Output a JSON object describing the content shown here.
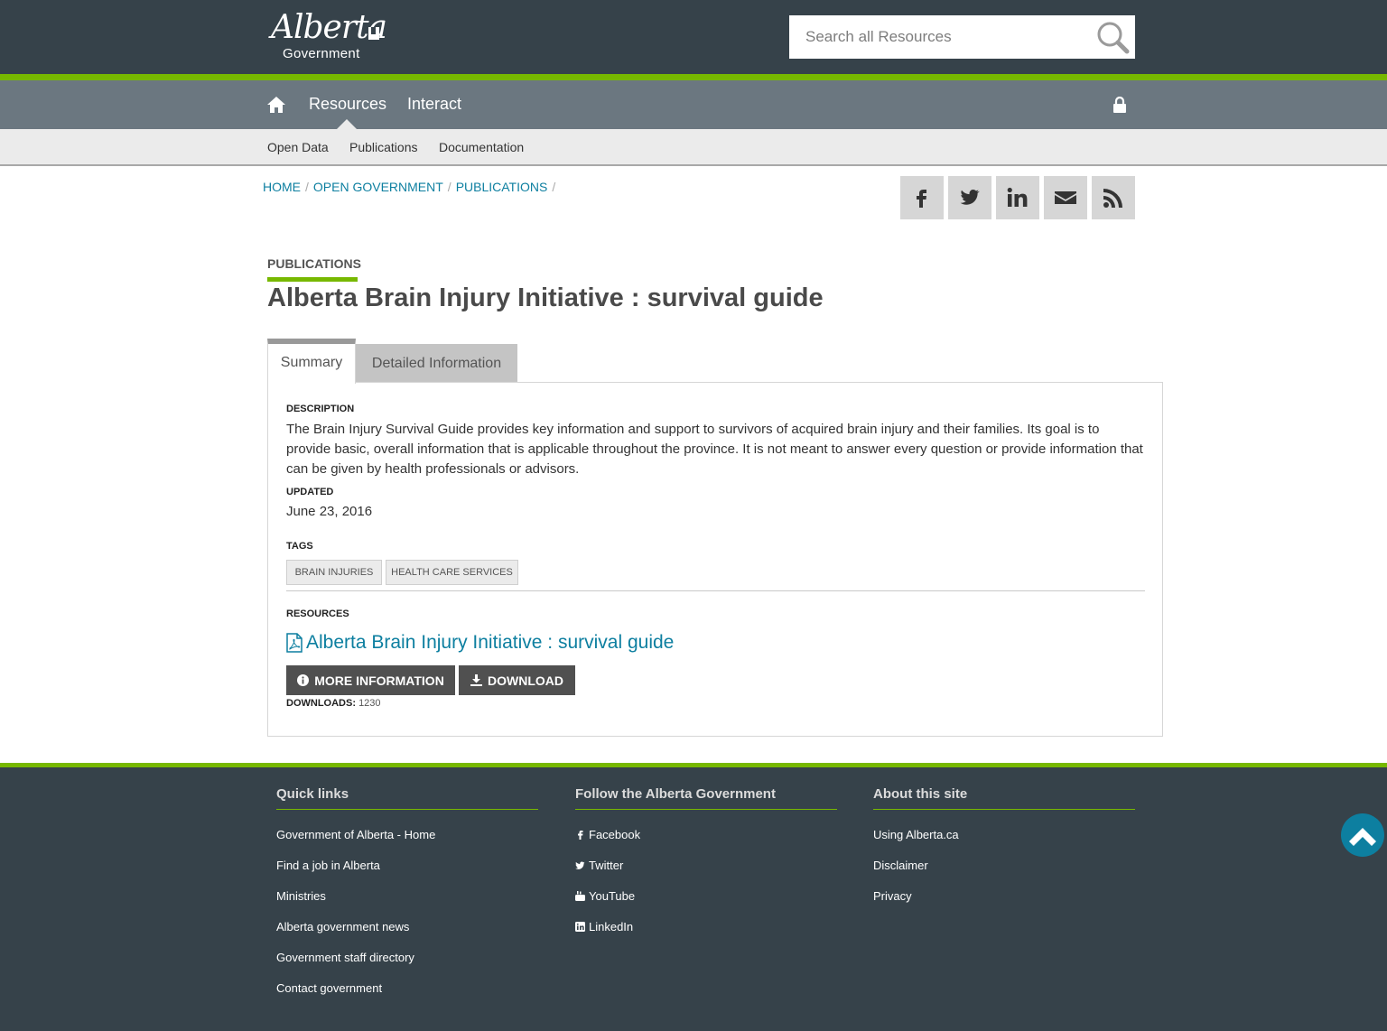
{
  "header": {
    "logo_script": "Alberta",
    "logo_sub": "Government",
    "search_placeholder": "Search all Resources"
  },
  "nav": {
    "items": [
      "Resources",
      "Interact"
    ],
    "subnav": [
      "Open Data",
      "Publications",
      "Documentation"
    ]
  },
  "breadcrumb": [
    "HOME",
    "OPEN GOVERNMENT",
    "PUBLICATIONS"
  ],
  "share_icons": [
    "facebook-icon",
    "twitter-icon",
    "linkedin-icon",
    "email-icon",
    "rss-icon"
  ],
  "page": {
    "kicker": "PUBLICATIONS",
    "title": "Alberta Brain Injury Initiative : survival guide"
  },
  "tabs": [
    "Summary",
    "Detailed Information"
  ],
  "summary": {
    "description_label": "DESCRIPTION",
    "description": "The Brain Injury Survival Guide provides key information and support to survivors of acquired brain injury and their families. Its goal is to provide basic, overall information that is applicable throughout the province. It is not meant to answer every question or provide information that can be given by health professionals or advisors.",
    "updated_label": "UPDATED",
    "updated": "June 23, 2016",
    "tags_label": "TAGS",
    "tags": [
      "BRAIN INJURIES",
      "HEALTH CARE SERVICES"
    ],
    "resources_label": "RESOURCES",
    "resource_title": "Alberta Brain Injury Initiative : survival guide",
    "more_info_label": "MORE INFORMATION",
    "download_label": "DOWNLOAD",
    "downloads_label": "DOWNLOADS:",
    "downloads_count": "1230"
  },
  "footer": {
    "quick_links_title": "Quick links",
    "quick_links": [
      "Government of Alberta - Home",
      "Find a job in Alberta",
      "Ministries",
      "Alberta government news",
      "Government staff directory",
      "Contact government"
    ],
    "follow_title": "Follow the Alberta Government",
    "follow": [
      "Facebook",
      "Twitter",
      "YouTube",
      "LinkedIn"
    ],
    "about_title": "About this site",
    "about": [
      "Using Alberta.ca",
      "Disclaimer",
      "Privacy"
    ]
  },
  "colors": {
    "header_bg": "#36424a",
    "accent_green": "#77b800",
    "nav_bg": "#6b7780",
    "link_blue": "#0d7fa0"
  }
}
